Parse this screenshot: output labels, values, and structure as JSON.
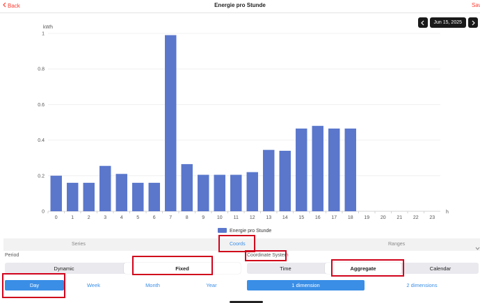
{
  "header": {
    "back_label": "Back",
    "title": "Energie pro Stunde",
    "save_label": "Save"
  },
  "date_nav": {
    "date": "Jun 15, 2025"
  },
  "chart_data": {
    "type": "bar",
    "ylabel": "kWh",
    "xlabel": "h",
    "ylim": [
      0,
      1
    ],
    "yticks": [
      "0",
      "0.2",
      "0.4",
      "0.6",
      "0.8",
      "1"
    ],
    "categories": [
      "0",
      "1",
      "2",
      "3",
      "4",
      "5",
      "6",
      "7",
      "8",
      "9",
      "10",
      "11",
      "12",
      "13",
      "14",
      "15",
      "16",
      "17",
      "18",
      "19",
      "20",
      "21",
      "22",
      "23"
    ],
    "series": [
      {
        "name": "Energie pro Stunde",
        "color": "#5a77cc",
        "values": [
          0.2,
          0.16,
          0.16,
          0.255,
          0.21,
          0.16,
          0.16,
          0.99,
          0.265,
          0.205,
          0.205,
          0.205,
          0.22,
          0.345,
          0.34,
          0.465,
          0.48,
          0.465,
          0.465,
          null,
          null,
          null,
          null,
          null
        ]
      }
    ],
    "grid": true,
    "legend": "bottom-center"
  },
  "tabs": {
    "series": "Series",
    "coords": "Coords",
    "ranges": "Ranges"
  },
  "period": {
    "label": "Period",
    "modes": [
      "Dynamic",
      "Fixed"
    ],
    "options": [
      "Day",
      "Week",
      "Month",
      "Year"
    ]
  },
  "coordinate_system": {
    "label": "Coordinate System",
    "modes": [
      "Time",
      "Aggregate",
      "Calendar"
    ],
    "dimensions": [
      "1 dimension",
      "2 dimensions"
    ]
  }
}
